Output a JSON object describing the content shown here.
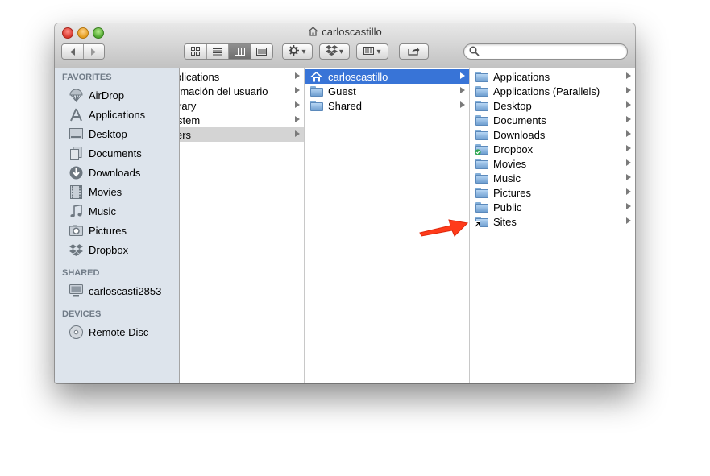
{
  "window": {
    "title": "carloscastillo"
  },
  "toolbar": {
    "back_icon": "back-arrow-icon",
    "forward_icon": "forward-arrow-icon",
    "view_buttons": [
      "icon-view",
      "list-view",
      "column-view",
      "coverflow-view"
    ],
    "active_view": "column-view",
    "action_icon": "gear-icon",
    "dropbox_icon": "dropbox-icon",
    "arrange_icon": "arrange-icon",
    "share_icon": "share-icon",
    "search": {
      "value": "",
      "placeholder": ""
    }
  },
  "sidebar": {
    "favorites_header": "FAVORITES",
    "favorites": [
      {
        "label": "AirDrop",
        "icon": "airdrop-icon"
      },
      {
        "label": "Applications",
        "icon": "applications-icon"
      },
      {
        "label": "Desktop",
        "icon": "desktop-icon"
      },
      {
        "label": "Documents",
        "icon": "documents-icon"
      },
      {
        "label": "Downloads",
        "icon": "downloads-icon"
      },
      {
        "label": "Movies",
        "icon": "movies-icon"
      },
      {
        "label": "Music",
        "icon": "music-icon"
      },
      {
        "label": "Pictures",
        "icon": "pictures-icon"
      },
      {
        "label": "Dropbox",
        "icon": "dropbox-icon"
      }
    ],
    "shared_header": "SHARED",
    "shared": [
      {
        "label": "carloscasti2853",
        "icon": "computer-icon"
      }
    ],
    "devices_header": "DEVICES",
    "devices": [
      {
        "label": "Remote Disc",
        "icon": "disc-icon"
      }
    ]
  },
  "columns": {
    "col1": [
      {
        "label": "plications",
        "has_children": true
      },
      {
        "label": "rmación del usuario",
        "has_children": true
      },
      {
        "label": "rary",
        "has_children": true
      },
      {
        "label": "stem",
        "has_children": true
      },
      {
        "label": "ers",
        "has_children": true,
        "selected": true
      }
    ],
    "col2": [
      {
        "label": "carloscastillo",
        "has_children": true,
        "selected": true,
        "icon": "home-icon"
      },
      {
        "label": "Guest",
        "has_children": true,
        "icon": "folder-icon"
      },
      {
        "label": "Shared",
        "has_children": true,
        "icon": "folder-icon"
      }
    ],
    "col3": [
      {
        "label": "Applications",
        "icon": "applications-folder-icon"
      },
      {
        "label": "Applications (Parallels)",
        "icon": "folder-icon"
      },
      {
        "label": "Desktop",
        "icon": "desktop-folder-icon"
      },
      {
        "label": "Documents",
        "icon": "documents-folder-icon"
      },
      {
        "label": "Downloads",
        "icon": "downloads-folder-icon"
      },
      {
        "label": "Dropbox",
        "icon": "dropbox-folder-icon"
      },
      {
        "label": "Movies",
        "icon": "movies-folder-icon"
      },
      {
        "label": "Music",
        "icon": "music-folder-icon"
      },
      {
        "label": "Pictures",
        "icon": "pictures-folder-icon"
      },
      {
        "label": "Public",
        "icon": "public-folder-icon"
      },
      {
        "label": "Sites",
        "icon": "sites-folder-icon"
      }
    ]
  },
  "annotation": {
    "arrow_color": "#ff3b1a",
    "arrow_target": "Sites"
  },
  "colors": {
    "selection": "#3874d7",
    "sidebar_bg": "#dde4ec"
  }
}
